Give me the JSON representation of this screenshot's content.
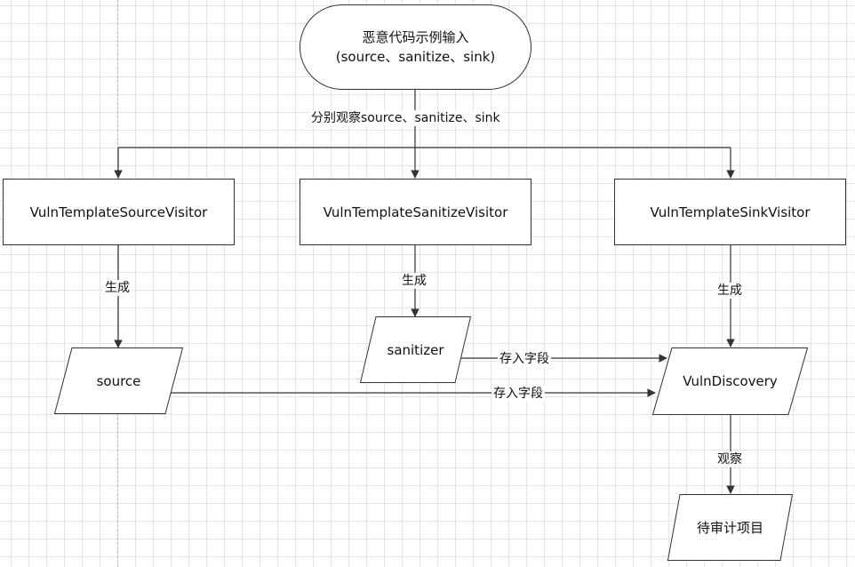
{
  "start": {
    "line1": "恶意代码示例输入",
    "line2": "(source、sanitize、sink)"
  },
  "observe_all_label": "分别观察source、sanitize、sink",
  "visitors": {
    "source": "VulnTemplateSourceVisitor",
    "sanitize": "VulnTemplateSanitizeVisitor",
    "sink": "VulnTemplateSinkVisitor"
  },
  "generate_label": "生成",
  "data_nodes": {
    "source": "source",
    "sanitizer": "sanitizer",
    "vuln_discovery": "VulnDiscovery",
    "audit_items": "待审计项目"
  },
  "store_field_label": "存入字段",
  "observe_label": "观察",
  "colors": {
    "stroke": "#333333",
    "grid": "#e4e4e4"
  }
}
